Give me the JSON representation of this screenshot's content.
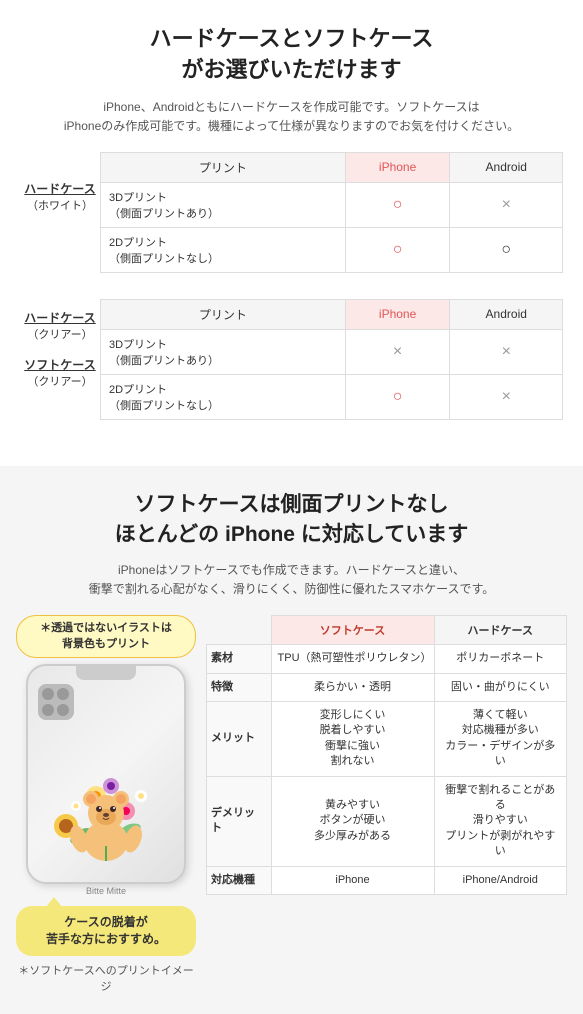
{
  "section1": {
    "title": "ハードケースとソフトケース\nがお選びいただけます",
    "subtitle": "iPhone、Androidともにハードケースを作成可能です。ソフトケースは\niPhoneのみ作成可能です。機種によって仕様が異なりますのでお気を付けください。",
    "table1": {
      "side_label_line1": "ハードケース",
      "side_label_line2": "（ホワイト）",
      "col_print": "プリント",
      "col_iphone": "iPhone",
      "col_android": "Android",
      "rows": [
        {
          "print": "3Dプリント\n（側面プリントあり）",
          "iphone": "○",
          "android": "×"
        },
        {
          "print": "2Dプリント\n（側面プリントなし）",
          "iphone": "○",
          "android": "○"
        }
      ]
    },
    "table2": {
      "side_label1_line1": "ハードケース",
      "side_label1_line2": "（クリアー）",
      "side_label2_line1": "ソフトケース",
      "side_label2_line2": "（クリアー）",
      "col_print": "プリント",
      "col_iphone": "iPhone",
      "col_android": "Android",
      "rows": [
        {
          "print": "3Dプリント\n（側面プリントあり）",
          "iphone": "×",
          "android": "×"
        },
        {
          "print": "2Dプリント\n（側面プリントなし）",
          "iphone": "○",
          "android": "×"
        }
      ]
    }
  },
  "section2": {
    "title": "ソフトケースは側面プリントなし\nほとんどの iPhone に対応しています",
    "subtitle": "iPhoneはソフトケースでも作成できます。ハードケースと違い、\n衝撃で割れる心配がなく、滑りにくく、防御性に優れたスマホケースです。",
    "transparent_note": "＊透過ではないイラストは\n背景色もプリント",
    "phone_brand": "Bitte Mitte",
    "soft_note": "＊ソフトケースへのプリントイメージ",
    "balloon_text": "ケースの脱着が\n苦手な方におすすめ。",
    "specs": {
      "headers": {
        "soft": "ソフトケース",
        "hard": "ハードケース"
      },
      "rows": [
        {
          "label": "素材",
          "soft": "TPU（熱可塑性ポリウレタン）",
          "hard": "ポリカーボネート"
        },
        {
          "label": "特徴",
          "soft": "柔らかい・透明",
          "hard": "固い・曲がりにくい"
        },
        {
          "label": "メリット",
          "soft": "変形しにくい\n脱着しやすい\n衝撃に強い\n割れない",
          "hard": "薄くて軽い\n対応機種が多い\nカラー・デザインが多い"
        },
        {
          "label": "デメリット",
          "soft": "黄みやすい\nボタンが硬い\n多少厚みがある",
          "hard": "衝撃で割れることがある\n滑りやすい\nプリントが剥がれやすい"
        },
        {
          "label": "対応機種",
          "soft": "iPhone",
          "hard": "iPhone/Android"
        }
      ]
    }
  }
}
